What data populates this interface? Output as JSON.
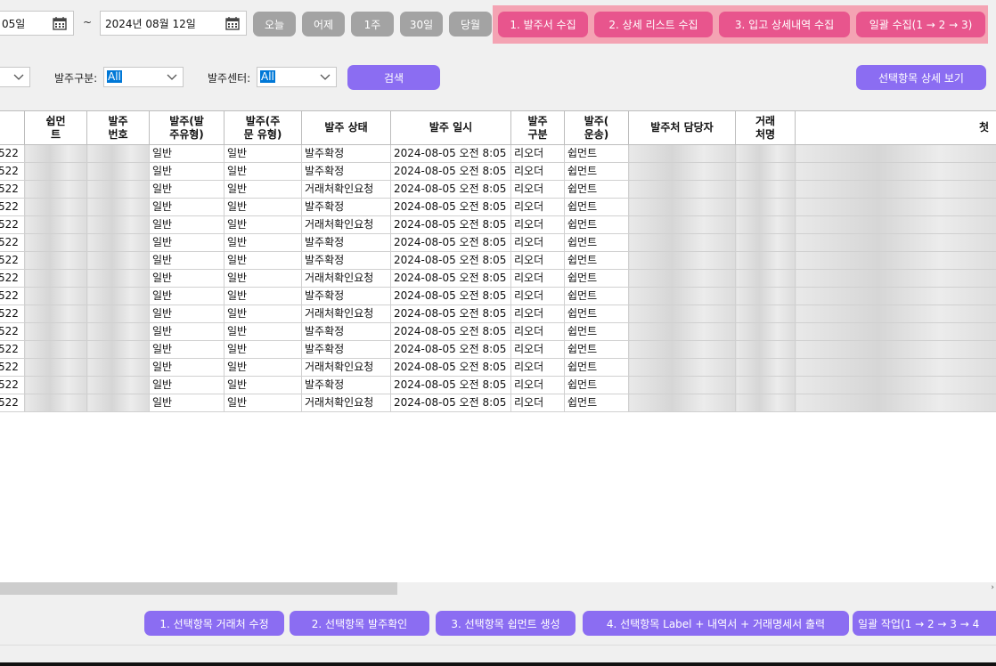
{
  "date_filter": {
    "start_text": "05일",
    "separator": "~",
    "end_text": "2024년 08월 12일",
    "calendar_icon": "calendar-icon"
  },
  "quick_range": [
    "오늘",
    "어제",
    "1주",
    "30일",
    "당월"
  ],
  "collect_buttons": [
    "1. 발주서 수집",
    "2. 상세 리스트 수집",
    "3. 입고 상세내역 수집",
    "일괄 수집(1 → 2 → 3)"
  ],
  "filters": {
    "order_type_label": "발주구분:",
    "order_type_value": "All",
    "center_label": "발주센터:",
    "center_value": "All"
  },
  "search_label": "검색",
  "detail_view_label": "선택항목 상세 보기",
  "table": {
    "columns": [
      "",
      "쉽먼\n트",
      "발주\n번호",
      "발주(발\n주유형)",
      "발주(주\n문 유형)",
      "발주 상태",
      "발주 일시",
      "발주\n구분",
      "발주(\n운송)",
      "발주처 담당자",
      "거래\n처명",
      "첫"
    ],
    "rows": [
      [
        "522",
        "일반",
        "일반",
        "발주확정",
        "2024-08-05 오전 8:05",
        "리오더",
        "쉽먼트"
      ],
      [
        "522",
        "일반",
        "일반",
        "발주확정",
        "2024-08-05 오전 8:05",
        "리오더",
        "쉽먼트"
      ],
      [
        "522",
        "일반",
        "일반",
        "거래처확인요청",
        "2024-08-05 오전 8:05",
        "리오더",
        "쉽먼트"
      ],
      [
        "522",
        "일반",
        "일반",
        "발주확정",
        "2024-08-05 오전 8:05",
        "리오더",
        "쉽먼트"
      ],
      [
        "522",
        "일반",
        "일반",
        "거래처확인요청",
        "2024-08-05 오전 8:05",
        "리오더",
        "쉽먼트"
      ],
      [
        "522",
        "일반",
        "일반",
        "발주확정",
        "2024-08-05 오전 8:05",
        "리오더",
        "쉽먼트"
      ],
      [
        "522",
        "일반",
        "일반",
        "발주확정",
        "2024-08-05 오전 8:05",
        "리오더",
        "쉽먼트"
      ],
      [
        "522",
        "일반",
        "일반",
        "거래처확인요청",
        "2024-08-05 오전 8:05",
        "리오더",
        "쉽먼트"
      ],
      [
        "522",
        "일반",
        "일반",
        "발주확정",
        "2024-08-05 오전 8:05",
        "리오더",
        "쉽먼트"
      ],
      [
        "522",
        "일반",
        "일반",
        "거래처확인요청",
        "2024-08-05 오전 8:05",
        "리오더",
        "쉽먼트"
      ],
      [
        "522",
        "일반",
        "일반",
        "발주확정",
        "2024-08-05 오전 8:05",
        "리오더",
        "쉽먼트"
      ],
      [
        "522",
        "일반",
        "일반",
        "발주확정",
        "2024-08-05 오전 8:05",
        "리오더",
        "쉽먼트"
      ],
      [
        "522",
        "일반",
        "일반",
        "거래처확인요청",
        "2024-08-05 오전 8:05",
        "리오더",
        "쉽먼트"
      ],
      [
        "522",
        "일반",
        "일반",
        "발주확정",
        "2024-08-05 오전 8:05",
        "리오더",
        "쉽먼트"
      ],
      [
        "522",
        "일반",
        "일반",
        "거래처확인요청",
        "2024-08-05 오전 8:05",
        "리오더",
        "쉽먼트"
      ]
    ]
  },
  "action_buttons": [
    "1. 선택항목 거래처 수정",
    "2. 선택항목 발주확인",
    "3. 선택항목 쉽먼트 생성",
    "4. 선택항목 Label + 내역서 + 거래명세서 출력",
    "일괄 작업(1 → 2 → 3 → 4"
  ],
  "colors": {
    "pink_panel": "#f4a3b3",
    "pink_button": "#e8558d",
    "purple_button": "#8b6df2",
    "gray_button": "#a3a3a3",
    "selection": "#0078d7"
  }
}
